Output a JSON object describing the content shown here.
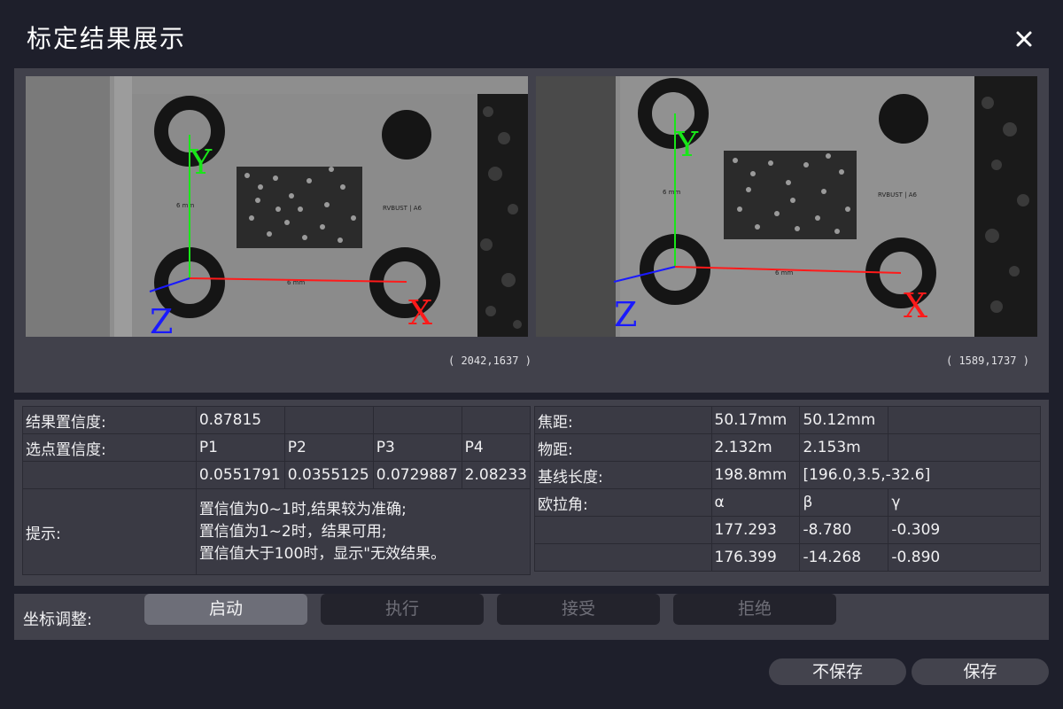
{
  "dialog": {
    "title": "标定结果展示",
    "close_icon": "close-icon"
  },
  "images": {
    "left": {
      "coord": "( 2042,1637 )",
      "axis_labels": {
        "x": "X",
        "y": "Y",
        "z": "Z"
      },
      "target_label": "RVBUST | A6",
      "mm_label_a": "6 mm",
      "mm_label_b": "6 mm"
    },
    "right": {
      "coord": "( 1589,1737 )",
      "axis_labels": {
        "x": "X",
        "y": "Y",
        "z": "Z"
      },
      "target_label": "RVBUST | A6",
      "mm_label_a": "6 mm",
      "mm_label_b": "6 mm"
    },
    "colors": {
      "x_axis": "#ff1a1a",
      "y_axis": "#19e619",
      "z_axis": "#1a1aff"
    }
  },
  "results": {
    "confidence_label": "结果置信度:",
    "confidence_value": "0.87815",
    "point_conf_label": "选点置信度:",
    "points": [
      "P1",
      "P2",
      "P3",
      "P4"
    ],
    "point_values": [
      "0.0551791",
      "0.0355125",
      "0.0729887",
      "2.08233"
    ],
    "hint_label": "提示:",
    "hint_lines": [
      "置信值为0~1时,结果较为准确;",
      "置信值为1~2时，结果可用;",
      "置信值大于100时，显示\"无效结果。"
    ]
  },
  "params": {
    "focal_label": "焦距:",
    "focal_values": [
      "50.17mm",
      "50.12mm"
    ],
    "distance_label": "物距:",
    "distance_values": [
      "2.132m",
      "2.153m"
    ],
    "baseline_label": "基线长度:",
    "baseline_values": [
      "198.8mm",
      "[196.0,3.5,-32.6]"
    ],
    "euler_label": "欧拉角:",
    "euler_headers": [
      "α",
      "β",
      "γ"
    ],
    "euler_rows": [
      [
        "177.293",
        "-8.780",
        "-0.309"
      ],
      [
        "176.399",
        "-14.268",
        "-0.890"
      ]
    ]
  },
  "adjust": {
    "label": "坐标调整:",
    "start": "启动",
    "execute": "执行",
    "accept": "接受",
    "reject": "拒绝"
  },
  "footer": {
    "dont_save": "不保存",
    "save": "保存"
  }
}
